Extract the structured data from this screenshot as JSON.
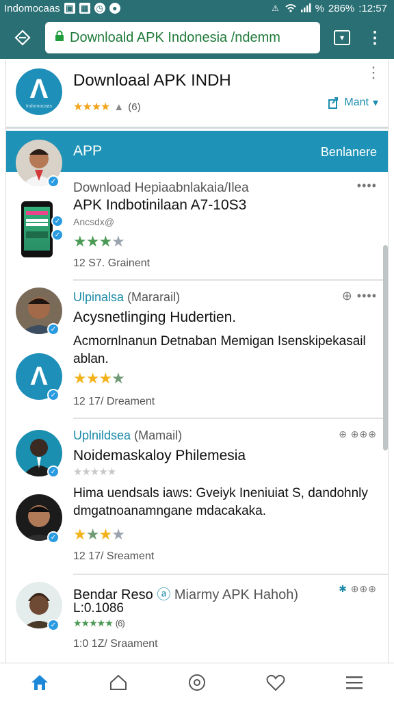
{
  "status_bar": {
    "carrier": "Indomocaas",
    "battery": "%",
    "battery_level": "286%",
    "time": ":12:57"
  },
  "browser": {
    "url_text": "Downloald APK Indonesia /ndemm"
  },
  "app": {
    "title": "Downloaal APK INDH",
    "logo_text": "Indomocaas",
    "rating_count": "(6)",
    "want_label": "Mant",
    "banner_label": "APP",
    "banner_right": "Benlanere"
  },
  "posts": [
    {
      "header": "Download Hepiaabnlakaia/Ilea",
      "title": "APK Indbotinilaan A7-10S3",
      "subline": "Ancsdx@",
      "stats": "12 S7. Grainent"
    },
    {
      "name": "Ulpinalsa",
      "handle": "(Mararail)",
      "title": "Acysnetlinging Hudertien.",
      "body": "Acmornlnanun Detnaban Memigan Isenskipekasail ablan.",
      "stats": "12 17/ Dreament"
    },
    {
      "name": "Uplnildsea",
      "handle": "(Mamail)",
      "title": "Noidemaskaloy Philemesia",
      "body": "Hima uendsals iaws: Gveiyk Ineniuiat S, dandohnly dmgatnoanamngane mdacakaka.",
      "stats": "12 17/ Sreament"
    },
    {
      "name": "Bendar Reso",
      "handle": "Miarmy APK Hahoh)",
      "title": "L:0.1086",
      "rating_count": "(6)",
      "stats": "1:0 1Z/ Sraament"
    }
  ],
  "colors": {
    "toolbar": "#2a6f74",
    "accent": "#1e93b7",
    "star_green": "#4a9a55",
    "star_gold": "#f3b21a"
  },
  "icons": [
    "wifi-icon",
    "signal-icon",
    "lock-icon",
    "more-vert-icon",
    "share-icon",
    "verified-badge-icon",
    "home-icon",
    "compass-icon",
    "heart-icon",
    "menu-icon"
  ]
}
